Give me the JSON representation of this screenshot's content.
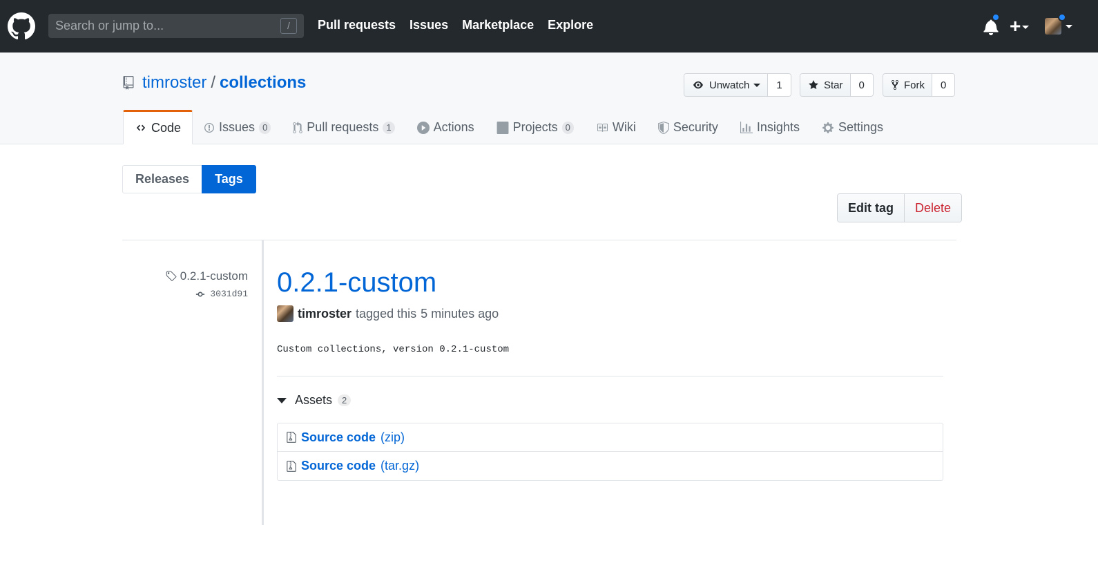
{
  "header": {
    "search_placeholder": "Search or jump to...",
    "search_shortcut": "/",
    "nav": [
      "Pull requests",
      "Issues",
      "Marketplace",
      "Explore"
    ],
    "plus": "+",
    "accent": "#2188ff"
  },
  "repo": {
    "owner": "timroster",
    "separator": "/",
    "name": "collections",
    "watch": {
      "label": "Unwatch",
      "count": "1"
    },
    "star": {
      "label": "Star",
      "count": "0"
    },
    "fork": {
      "label": "Fork",
      "count": "0"
    }
  },
  "reponav": {
    "code": "Code",
    "issues": {
      "label": "Issues",
      "count": "0"
    },
    "pulls": {
      "label": "Pull requests",
      "count": "1"
    },
    "actions": "Actions",
    "projects": {
      "label": "Projects",
      "count": "0"
    },
    "wiki": "Wiki",
    "security": "Security",
    "insights": "Insights",
    "settings": "Settings",
    "selected_color": "#e36209"
  },
  "subnav": {
    "releases": "Releases",
    "tags": "Tags"
  },
  "tag_actions": {
    "edit": "Edit tag",
    "delete": "Delete"
  },
  "release": {
    "meta_tag": "0.2.1-custom",
    "meta_commit": "3031d91",
    "title": "0.2.1-custom",
    "author": "timroster",
    "tagged_text": "tagged this",
    "time": "5 minutes ago",
    "description": "Custom collections, version 0.2.1-custom",
    "assets_label": "Assets",
    "assets_count": "2",
    "assets": [
      {
        "name": "Source code",
        "format": "(zip)"
      },
      {
        "name": "Source code",
        "format": "(tar.gz)"
      }
    ]
  }
}
